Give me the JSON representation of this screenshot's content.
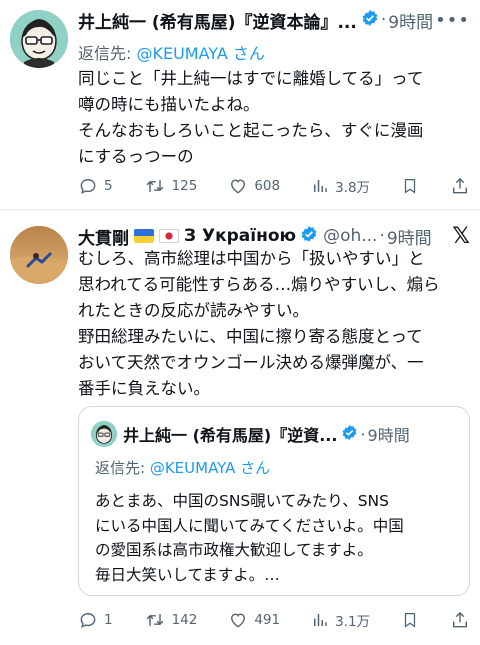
{
  "colors": {
    "accent": "#1d9bf0",
    "muted": "#536471",
    "text": "#0f1419"
  },
  "tweets": [
    {
      "author_name": "井上純一 (希有馬屋)『逆資本論』...",
      "verified_icon": "verified-badge-icon",
      "time": "9時間",
      "more_icon": "more-dots-icon",
      "reply_prefix": "返信先: ",
      "reply_to": "@KEUMAYA さん",
      "lines": [
        "同じこと「井上純一はすでに離婚してる」って",
        "噂の時にも描いたよね。",
        "そんなおもしろいこと起こったら、すぐに漫画",
        "にするっつーの"
      ],
      "stats": {
        "replies": "5",
        "retweets": "125",
        "likes": "608",
        "views": "3.8万"
      }
    },
    {
      "author_name": "大貫剛",
      "flags": [
        "ukraine-flag-icon",
        "japan-flag-icon"
      ],
      "name_suffix": "З Україною",
      "handle": "@oh...",
      "time": "9時間",
      "x_logo": "𝕏",
      "lines": [
        "むしろ、高市総理は中国から「扱いやすい」と",
        "思われてる可能性すらある…煽りやすいし、煽ら",
        "れたときの反応が読みやすい。",
        "野田総理みたいに、中国に擦り寄る態度とって",
        "おいて天然でオウンゴール決める爆弾魔が、一",
        "番手に負えない。"
      ],
      "stats": {
        "replies": "1",
        "retweets": "142",
        "likes": "491",
        "views": "3.1万"
      },
      "quote": {
        "author_name": "井上純一 (希有馬屋)『逆資...",
        "time": "9時間",
        "reply_prefix": "返信先: ",
        "reply_to": "@KEUMAYA さん",
        "lines": [
          "あとまあ、中国のSNS覗いてみたり、SNS",
          "にいる中国人に聞いてみてくださいよ。中国",
          "の愛国系は高市政権大歓迎してますよ。",
          "毎日大笑いしてますよ。…"
        ]
      }
    }
  ]
}
